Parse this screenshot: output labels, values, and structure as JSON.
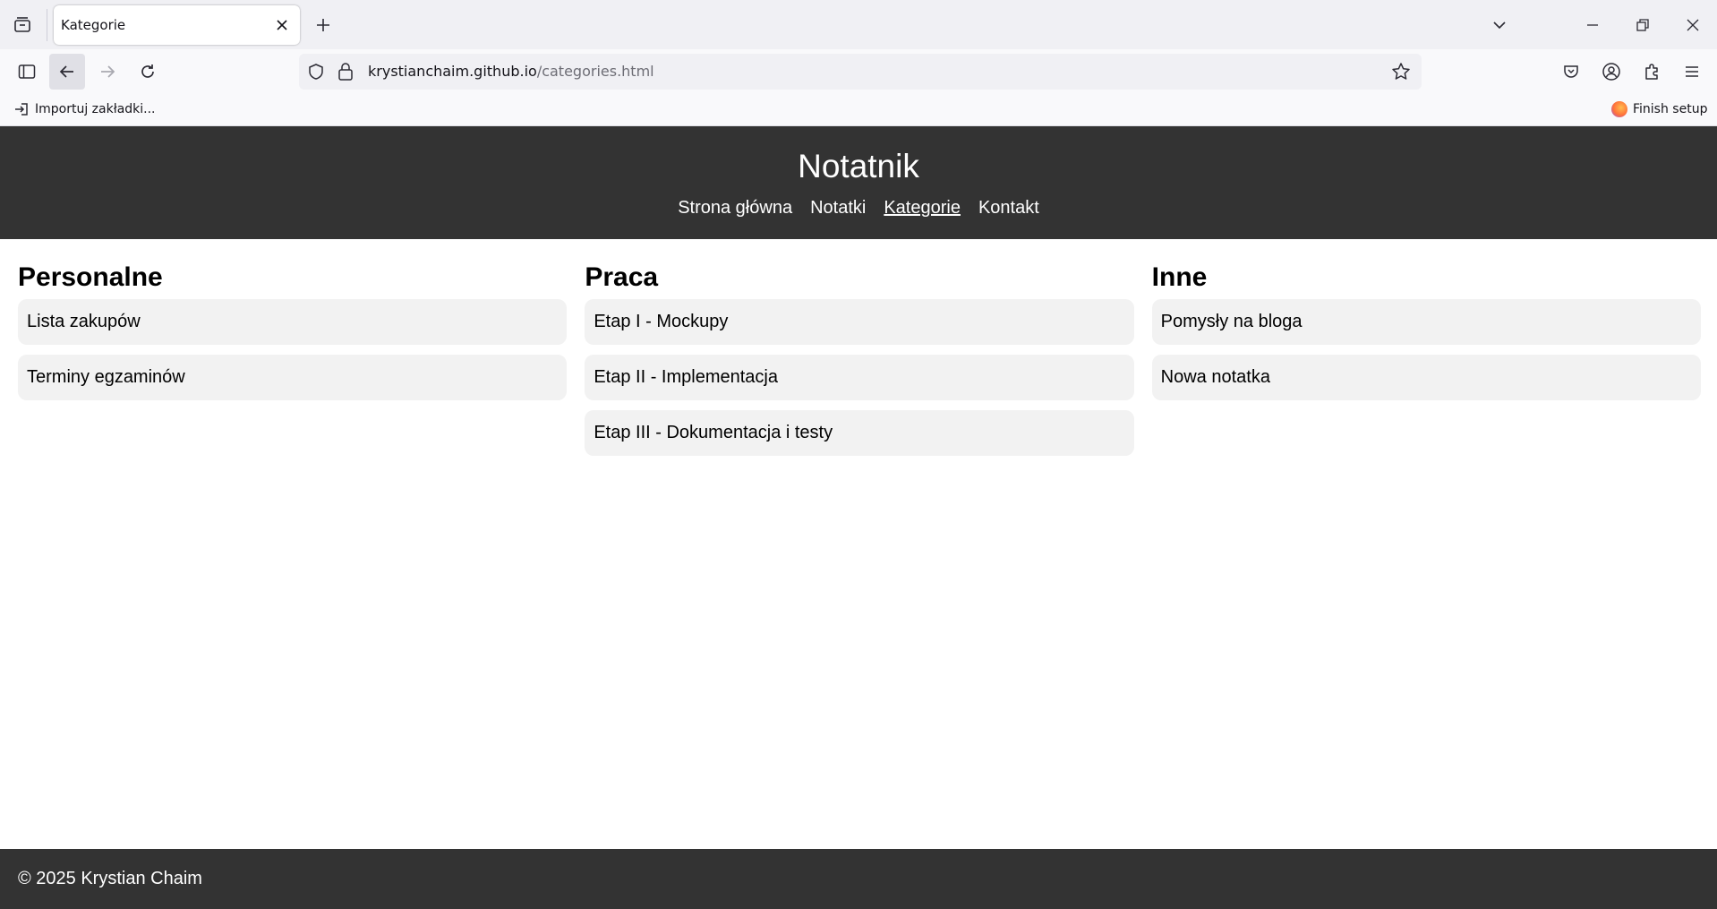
{
  "browser": {
    "tab": {
      "title": "Kategorie"
    },
    "url": {
      "host": "krystianchaim.github.io",
      "path": "/categories.html"
    },
    "bookmarks": {
      "import_label": "Importuj zakładki...",
      "finish_setup_label": "Finish setup"
    }
  },
  "site": {
    "title": "Notatnik",
    "nav": [
      {
        "label": "Strona główna",
        "active": false
      },
      {
        "label": "Notatki",
        "active": false
      },
      {
        "label": "Kategorie",
        "active": true
      },
      {
        "label": "Kontakt",
        "active": false
      }
    ],
    "categories": [
      {
        "title": "Personalne",
        "notes": [
          "Lista zakupów",
          "Terminy egzaminów"
        ]
      },
      {
        "title": "Praca",
        "notes": [
          "Etap I - Mockupy",
          "Etap II - Implementacja",
          "Etap III - Dokumentacja i testy"
        ]
      },
      {
        "title": "Inne",
        "notes": [
          "Pomysły na bloga",
          "Nowa notatka"
        ]
      }
    ],
    "footer": "© 2025 Krystian Chaim"
  },
  "colors": {
    "header_bg": "#333333",
    "note_bg": "#f2f2f2",
    "firefox_accent": "#ff7139"
  }
}
